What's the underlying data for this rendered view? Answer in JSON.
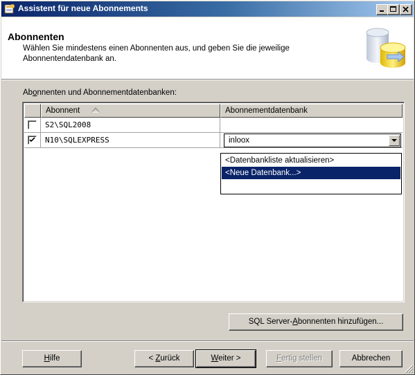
{
  "window": {
    "title": "Assistent für neue Abonnements"
  },
  "header": {
    "title": "Abonnenten",
    "description": "Wählen Sie mindestens einen Abonnenten aus, und geben Sie die jeweilige Abonnentendatenbank an."
  },
  "list": {
    "label_pre": "Ab",
    "label_accel": "o",
    "label_post": "nnenten und Abonnementdatenbanken:",
    "columns": [
      "Abonnent",
      "Abonnementdatenbank"
    ],
    "sort_indicator": "ascending",
    "rows": [
      {
        "checked": false,
        "subscriber": "S2\\SQL2008",
        "database": ""
      },
      {
        "checked": true,
        "subscriber": "N10\\SQLEXPRESS",
        "database": "inloox"
      }
    ]
  },
  "dropdown": {
    "options": [
      "<Datenbankliste aktualisieren>",
      "<Neue Datenbank...>"
    ],
    "selected_index": 1
  },
  "buttons": {
    "add_subscriber_pre": "SQL Server-",
    "add_subscriber_accel": "A",
    "add_subscriber_post": "bonnenten hinzufügen...",
    "help_accel": "H",
    "help_post": "ilfe",
    "back_pre": "< ",
    "back_accel": "Z",
    "back_post": "urück",
    "next_accel": "W",
    "next_post": "eiter >",
    "finish_accel": "F",
    "finish_post": "ertig stellen",
    "cancel": "Abbrechen"
  },
  "colors": {
    "title_gradient_start": "#0a246a",
    "title_gradient_end": "#a6caf0",
    "selection": "#0a246a",
    "face": "#d4d0c8"
  },
  "icons": [
    "wizard-app-icon",
    "minimize-icon",
    "maximize-icon",
    "close-icon",
    "database-header-icon",
    "sort-ascending-icon",
    "dropdown-arrow-icon",
    "checkmark-icon",
    "size-grip-icon"
  ]
}
